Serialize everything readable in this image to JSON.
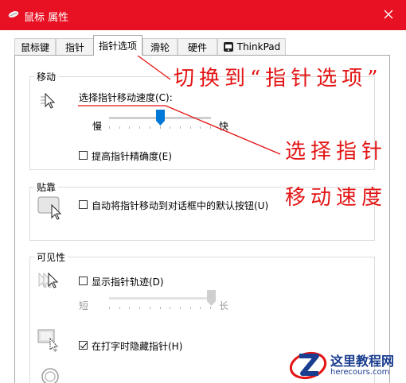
{
  "window": {
    "title": "鼠标 属性"
  },
  "tabs": [
    {
      "label": "鼠标键"
    },
    {
      "label": "指针"
    },
    {
      "label": "指针选项"
    },
    {
      "label": "滑轮"
    },
    {
      "label": "硬件"
    },
    {
      "label": "ThinkPad"
    }
  ],
  "active_tab": "指针选项",
  "motion": {
    "group_title": "移动",
    "speed_label": "选择指针移动速度(C):",
    "slow_label": "慢",
    "fast_label": "快",
    "speed_level": 0.5,
    "precision_checkbox_label": "提高指针精确度(E)",
    "precision_checked": false
  },
  "snap_to": {
    "group_title": "贴靠",
    "checkbox_label": "自动将指针移动到对话框中的默认按钮(U)",
    "checked": false
  },
  "visibility": {
    "group_title": "可见性",
    "trails_checkbox_label": "显示指针轨迹(D)",
    "trails_checked": false,
    "short_label": "短",
    "long_label": "长",
    "trails_level": 1.0,
    "hide_checkbox_label": "在打字时隐藏指针(H)",
    "hide_checked": true
  },
  "annotations": {
    "switch_tab": "切换到“指针选项”",
    "select_pointer": "选择指针",
    "move_speed": "移动速度"
  },
  "watermark": {
    "title": "这里教程网",
    "url": "herecours.com"
  },
  "colors": {
    "titlebar": "#e81123",
    "annotation": "#e31414",
    "slider_thumb": "#0078d7"
  }
}
